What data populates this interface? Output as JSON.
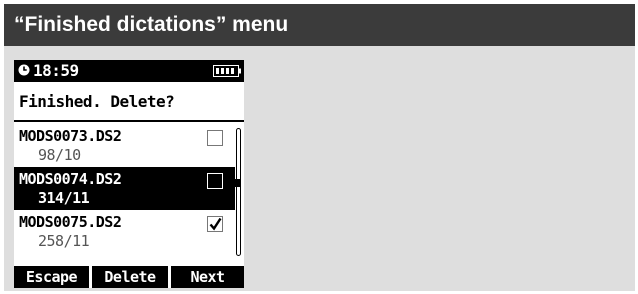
{
  "header": {
    "title": "“Finished dictations” menu"
  },
  "device": {
    "status": {
      "time": "18:59",
      "clock_icon": "clock-icon",
      "battery_icon": "battery-icon"
    },
    "prompt": "Finished. Delete?",
    "files": [
      {
        "name": "MODS0073.DS2",
        "duration": "98/10",
        "checked": false,
        "selected": false
      },
      {
        "name": "MODS0074.DS2",
        "duration": "314/11",
        "checked": false,
        "selected": true
      },
      {
        "name": "MODS0075.DS2",
        "duration": "258/11",
        "checked": true,
        "selected": false
      }
    ],
    "softkeys": {
      "left": "Escape",
      "middle": "Delete",
      "right": "Next"
    }
  },
  "colors": {
    "title_bar": "#3b3b3b",
    "canvas": "#dedede",
    "screen_background": "#ffffff",
    "inverse": "#000000"
  }
}
